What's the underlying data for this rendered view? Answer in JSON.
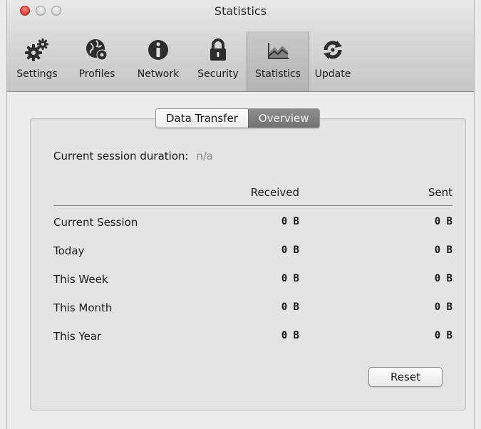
{
  "window": {
    "title": "Statistics"
  },
  "toolbar": {
    "items": [
      {
        "label": "Settings",
        "icon": "gears-icon"
      },
      {
        "label": "Profiles",
        "icon": "globe-gear-icon"
      },
      {
        "label": "Network",
        "icon": "info-icon"
      },
      {
        "label": "Security",
        "icon": "lock-icon"
      },
      {
        "label": "Statistics",
        "icon": "chart-icon",
        "selected": true
      },
      {
        "label": "Update",
        "icon": "refresh-icon"
      }
    ]
  },
  "segmented": {
    "options": [
      "Data Transfer",
      "Overview"
    ],
    "selected": "Overview"
  },
  "session": {
    "label": "Current session duration:",
    "value": "n/a"
  },
  "table": {
    "columns": [
      "Received",
      "Sent"
    ],
    "rows": [
      {
        "label": "Current Session",
        "received": "0 B",
        "sent": "0 B"
      },
      {
        "label": "Today",
        "received": "0 B",
        "sent": "0 B"
      },
      {
        "label": "This Week",
        "received": "0 B",
        "sent": "0 B"
      },
      {
        "label": "This Month",
        "received": "0 B",
        "sent": "0 B"
      },
      {
        "label": "This Year",
        "received": "0 B",
        "sent": "0 B"
      }
    ]
  },
  "reset_label": "Reset",
  "colors": {
    "selected_segment": "#7d7d7d",
    "close_light": "#e0443e"
  }
}
